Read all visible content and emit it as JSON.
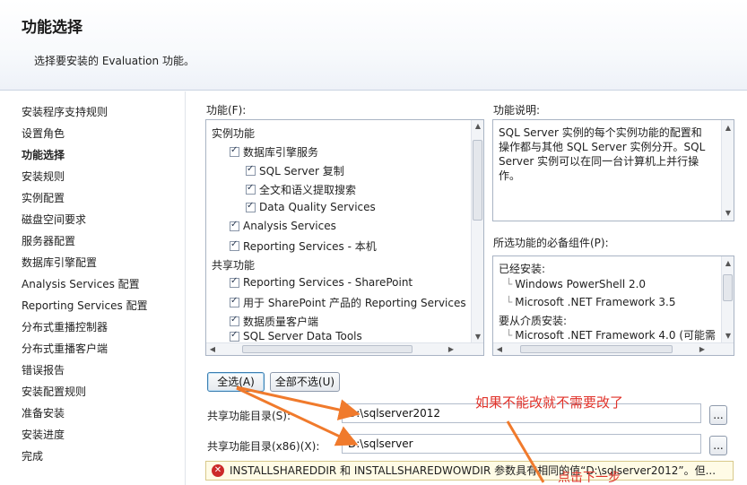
{
  "header": {
    "title": "功能选择",
    "subtitle": "选择要安装的 Evaluation 功能。"
  },
  "sidebar": {
    "items": [
      {
        "label": "安装程序支持规则"
      },
      {
        "label": "设置角色"
      },
      {
        "label": "功能选择",
        "active": true
      },
      {
        "label": "安装规则"
      },
      {
        "label": "实例配置"
      },
      {
        "label": "磁盘空间要求"
      },
      {
        "label": "服务器配置"
      },
      {
        "label": "数据库引擎配置"
      },
      {
        "label": "Analysis Services 配置"
      },
      {
        "label": "Reporting Services 配置"
      },
      {
        "label": "分布式重播控制器"
      },
      {
        "label": "分布式重播客户端"
      },
      {
        "label": "错误报告"
      },
      {
        "label": "安装配置规则"
      },
      {
        "label": "准备安装"
      },
      {
        "label": "安装进度"
      },
      {
        "label": "完成"
      }
    ]
  },
  "features": {
    "label": "功能(F):",
    "tree": [
      {
        "label": "实例功能",
        "checkbox": false,
        "checked": false,
        "level": 0
      },
      {
        "label": "数据库引擎服务",
        "checkbox": true,
        "checked": true,
        "level": 1
      },
      {
        "label": "SQL Server 复制",
        "checkbox": true,
        "checked": true,
        "level": 2
      },
      {
        "label": "全文和语义提取搜索",
        "checkbox": true,
        "checked": true,
        "level": 2
      },
      {
        "label": "Data Quality Services",
        "checkbox": true,
        "checked": true,
        "level": 2
      },
      {
        "label": "Analysis Services",
        "checkbox": true,
        "checked": true,
        "level": 1
      },
      {
        "label": "Reporting Services - 本机",
        "checkbox": true,
        "checked": true,
        "level": 1
      },
      {
        "label": "共享功能",
        "checkbox": false,
        "checked": false,
        "level": 0
      },
      {
        "label": "Reporting Services - SharePoint",
        "checkbox": true,
        "checked": true,
        "level": 1
      },
      {
        "label": "用于 SharePoint 产品的 Reporting Services",
        "checkbox": true,
        "checked": true,
        "level": 1
      },
      {
        "label": "数据质量客户端",
        "checkbox": true,
        "checked": true,
        "level": 1
      },
      {
        "label": "SQL Server Data Tools",
        "checkbox": true,
        "checked": true,
        "level": 1
      }
    ]
  },
  "description": {
    "label": "功能说明:",
    "text": "SQL Server 实例的每个实例功能的配置和操作都与其他 SQL Server 实例分开。SQL Server 实例可以在同一台计算机上并行操作。"
  },
  "prerequisites": {
    "label": "所选功能的必备组件(P):",
    "tree": [
      {
        "label": "已经安装:",
        "level": 0
      },
      {
        "label": "Windows PowerShell 2.0",
        "level": 1
      },
      {
        "label": "Microsoft .NET Framework 3.5",
        "level": 1
      },
      {
        "label": "要从介质安装:",
        "level": 0
      },
      {
        "label": "Microsoft .NET Framework 4.0 (可能需",
        "level": 1
      }
    ]
  },
  "buttons": {
    "select_all": "全选(A)",
    "deselect_all": "全部不选(U)",
    "browse": "..."
  },
  "shared_dir": {
    "label": "共享功能目录(S):",
    "value": "D:\\sqlserver2012"
  },
  "shared_dir_x86": {
    "label": "共享功能目录(x86)(X):",
    "value": "D:\\sqlserver"
  },
  "error": {
    "text": "INSTALLSHAREDDIR 和 INSTALLSHAREDWOWDIR 参数具有相同的值“D:\\sqlserver2012”。但..."
  },
  "annotations": {
    "note1": "如果不能改就不需要改了",
    "note2": "点击下一步"
  },
  "colors": {
    "annotation": "#e0322a",
    "arrow": "#f07a2c",
    "error_icon": "#cc2a2a"
  }
}
